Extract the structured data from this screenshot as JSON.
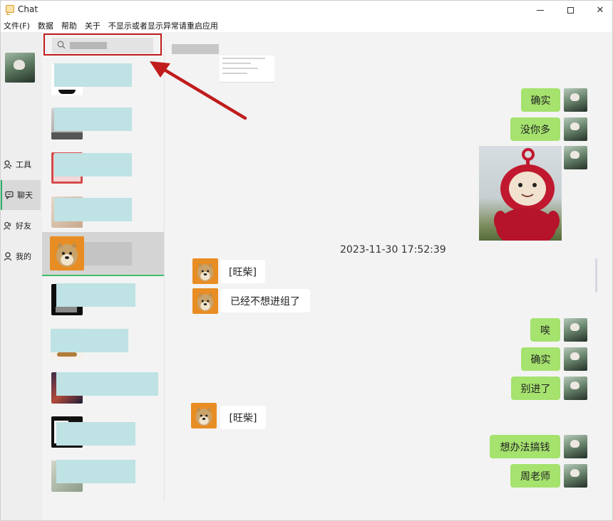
{
  "window": {
    "title": "Chat"
  },
  "menubar": {
    "items": [
      "文件(F)",
      "数据",
      "帮助",
      "关于",
      "不显示或者显示异常请重启应用"
    ]
  },
  "nav": {
    "items": [
      {
        "label": "工具",
        "icon": "user-tool-icon"
      },
      {
        "label": "聊天",
        "icon": "chat-bubble-icon",
        "active": true
      },
      {
        "label": "好友",
        "icon": "friends-icon"
      },
      {
        "label": "我的",
        "icon": "me-icon"
      }
    ]
  },
  "search": {
    "icon": "search-icon"
  },
  "messages": [
    {
      "side": "me",
      "text": "确实"
    },
    {
      "side": "me",
      "text": "没你多"
    },
    {
      "side": "me",
      "type": "image",
      "icon": "teletubby-sticker"
    },
    {
      "type": "timestamp",
      "text": "2023-11-30 17:52:39"
    },
    {
      "side": "them",
      "text": "[旺柴]"
    },
    {
      "side": "them",
      "text": "已经不想进组了"
    },
    {
      "side": "me",
      "text": "唉"
    },
    {
      "side": "me",
      "text": "确实"
    },
    {
      "side": "me",
      "text": "别进了"
    },
    {
      "side": "them",
      "text": "[旺柴]"
    },
    {
      "side": "me",
      "text": "想办法搞钱"
    },
    {
      "side": "me",
      "text": "周老师"
    }
  ],
  "colors": {
    "my_bubble": "#a5e26e",
    "their_bubble": "#ffffff",
    "active_accent": "#2aae67",
    "annotation": "#c01c1c"
  }
}
